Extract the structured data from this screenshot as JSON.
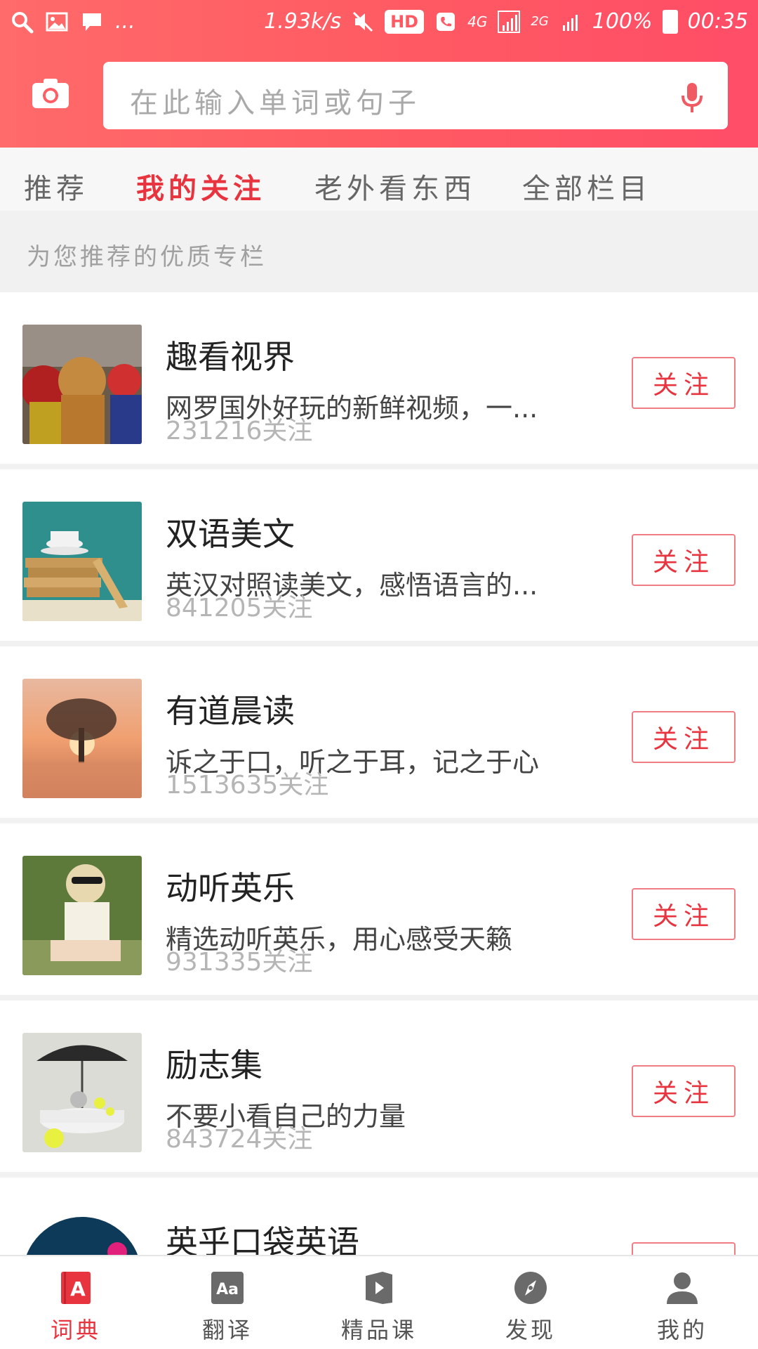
{
  "status_bar": {
    "speed": "1.93k/s",
    "hd": "HD",
    "network": "4G",
    "network2": "2G",
    "battery": "100%",
    "time": "00:35",
    "more": "..."
  },
  "search": {
    "placeholder": "在此输入单词或句子"
  },
  "tabs": [
    {
      "label": "推荐"
    },
    {
      "label": "我的关注"
    },
    {
      "label": "老外看东西"
    },
    {
      "label": "全部栏目"
    }
  ],
  "section_caption": "为您推荐的优质专栏",
  "follow_label": "关注",
  "items": [
    {
      "title": "趣看视界",
      "desc": "网罗国外好玩的新鲜视频，一...",
      "count": "231216关注"
    },
    {
      "title": "双语美文",
      "desc": "英汉对照读美文，感悟语言的...",
      "count": "841205关注"
    },
    {
      "title": "有道晨读",
      "desc": "诉之于口，听之于耳，记之于心",
      "count": "1513635关注"
    },
    {
      "title": "动听英乐",
      "desc": "精选动听英乐，用心感受天籁",
      "count": "931335关注"
    },
    {
      "title": "励志集",
      "desc": "不要小看自己的力量",
      "count": "843724关注"
    },
    {
      "title": "英乎口袋英语",
      "desc": "",
      "count": ""
    }
  ],
  "bottom_nav": [
    {
      "label": "词典",
      "icon": "dictionary-icon"
    },
    {
      "label": "翻译",
      "icon": "translate-icon"
    },
    {
      "label": "精品课",
      "icon": "course-icon"
    },
    {
      "label": "发现",
      "icon": "compass-icon"
    },
    {
      "label": "我的",
      "icon": "profile-icon"
    }
  ],
  "colors": {
    "accent": "#e8343f",
    "header": "#ff5a63"
  }
}
